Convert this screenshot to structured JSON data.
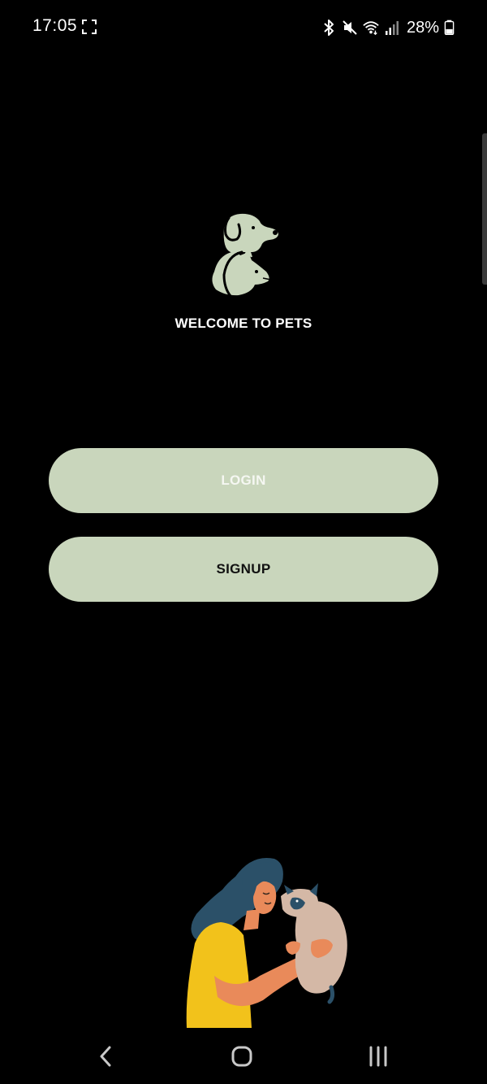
{
  "status_bar": {
    "time": "17:05",
    "battery": "28%",
    "icons": [
      "screenshot-icon",
      "bluetooth-icon",
      "mute-icon",
      "wifi-icon",
      "signal-icon",
      "battery-icon"
    ]
  },
  "logo": {
    "icon": "dog-cat-logo-icon",
    "color": "#c9d6bc"
  },
  "welcome": {
    "title": "WELCOME TO PETS"
  },
  "buttons": {
    "login_label": "LOGIN",
    "signup_label": "SIGNUP",
    "color": "#c9d6bc"
  },
  "illustration": {
    "icon": "woman-holding-cat-illustration"
  },
  "nav_bar": {
    "icons": [
      "back-icon",
      "home-icon",
      "recents-icon"
    ]
  }
}
